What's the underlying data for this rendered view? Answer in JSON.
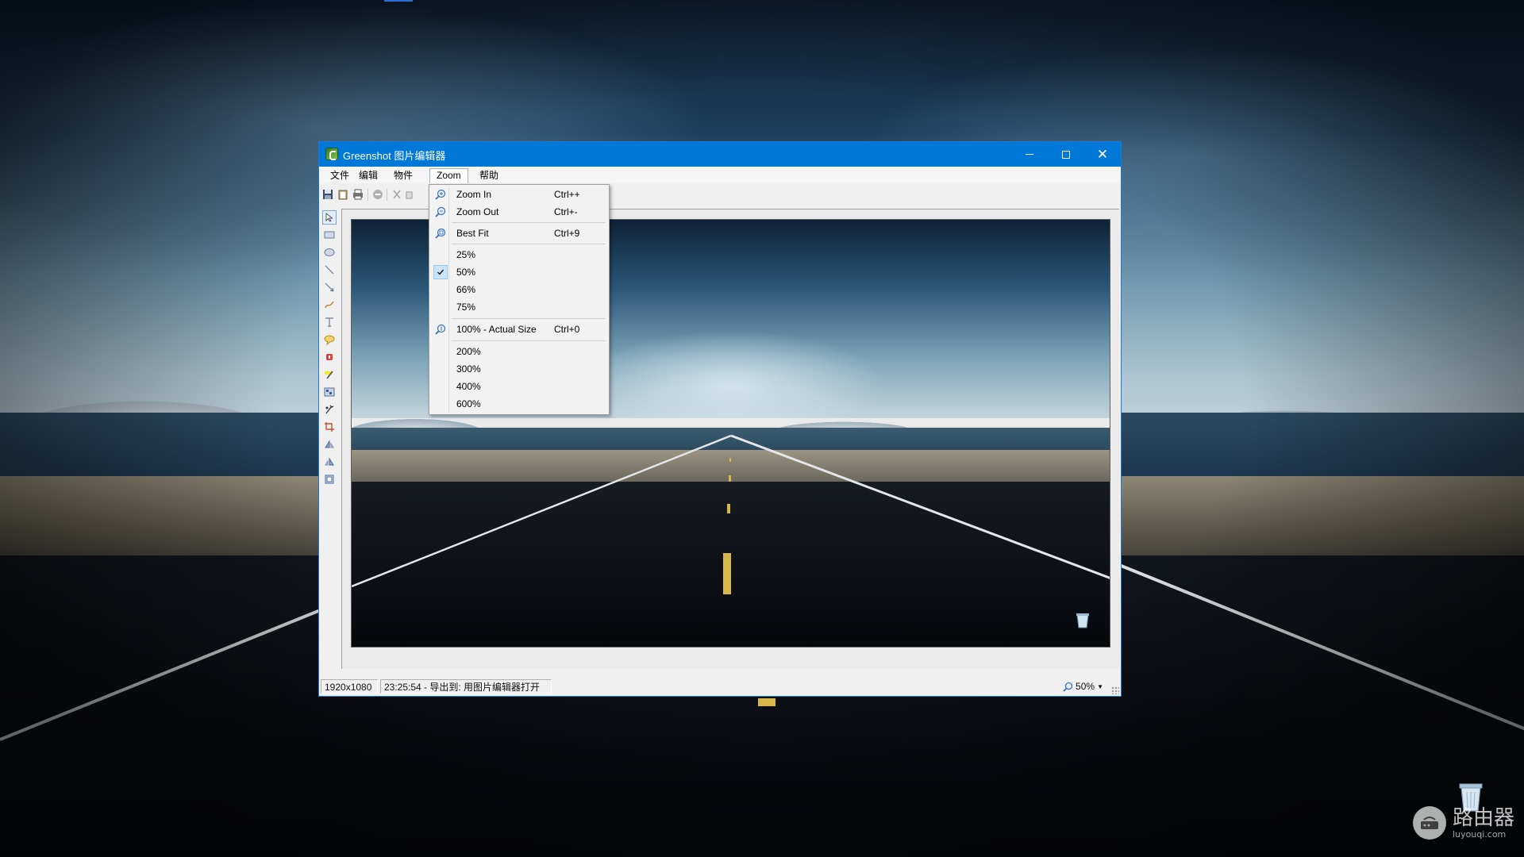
{
  "window": {
    "title": "Greenshot 图片编辑器",
    "controls": {
      "minimize": "minimize",
      "maximize": "maximize",
      "close": "close"
    }
  },
  "menubar": {
    "items": [
      {
        "label": "文件"
      },
      {
        "label": "编辑"
      },
      {
        "label": "物件"
      },
      {
        "label": "Zoom",
        "active": true
      },
      {
        "label": "帮助"
      }
    ]
  },
  "toolbar": {
    "buttons": [
      "save-icon",
      "clipboard-icon",
      "print-icon",
      "delete-icon",
      "cut-icon",
      "copy-icon"
    ]
  },
  "tools": [
    "select-icon",
    "rectangle-icon",
    "ellipse-icon",
    "line-icon",
    "arrow-icon",
    "freehand-icon",
    "text-icon",
    "speechbubble-icon",
    "stepcounter-icon",
    "highlight-icon",
    "obfuscate-icon",
    "effects-icon",
    "crop-icon",
    "rotate-cw-icon",
    "rotate-ccw-icon",
    "resize-icon"
  ],
  "zoom_menu": {
    "items": [
      {
        "label": "Zoom In",
        "shortcut": "Ctrl++",
        "icon": "zoom-in-icon"
      },
      {
        "label": "Zoom Out",
        "shortcut": "Ctrl+-",
        "icon": "zoom-out-icon"
      },
      {
        "label": "Best Fit",
        "shortcut": "Ctrl+9",
        "icon": "zoom-fit-icon"
      },
      {
        "label": "25%"
      },
      {
        "label": "50%",
        "checked": true
      },
      {
        "label": "66%"
      },
      {
        "label": "75%"
      },
      {
        "label": "100% - Actual Size",
        "shortcut": "Ctrl+0",
        "icon": "zoom-actual-icon"
      },
      {
        "label": "200%"
      },
      {
        "label": "300%"
      },
      {
        "label": "400%"
      },
      {
        "label": "600%"
      }
    ]
  },
  "statusbar": {
    "dimensions": "1920x1080",
    "message": "23:25:54 - 导出到: 用图片编辑器打开",
    "zoom": "50%"
  },
  "watermark": {
    "title": "路由器",
    "sub": "luyouqi.com"
  },
  "colors": {
    "titlebar": "#0078d7",
    "menu_check": "#cce4f7"
  }
}
